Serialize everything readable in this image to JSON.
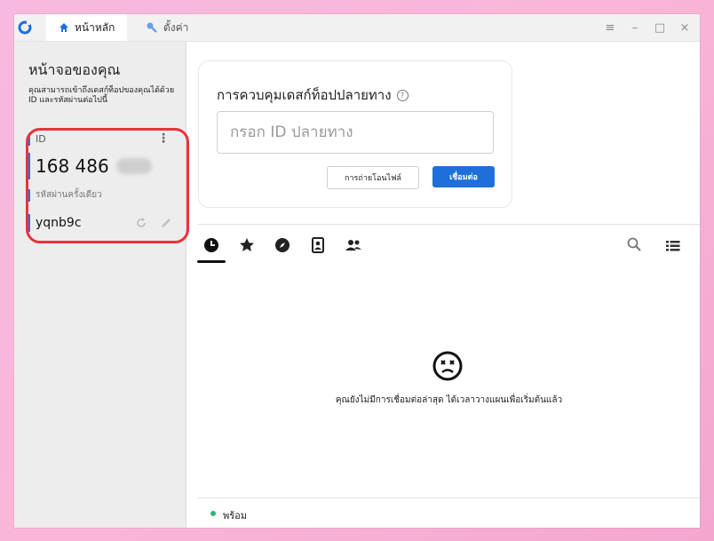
{
  "titlebar": {
    "tabs": [
      {
        "label": "หน้าหลัก",
        "icon": "home-icon"
      },
      {
        "label": "ตั้งค่า",
        "icon": "wrench-icon"
      }
    ],
    "controls": {
      "menu": "≡",
      "minimize": "–",
      "maximize": "□",
      "close": "×"
    }
  },
  "sidebar": {
    "title": "หน้าจอของคุณ",
    "description": "คุณสามารถเข้าถึงเดสก์ท็อปของคุณได้ด้วย ID และรหัสผ่านต่อไปนี้",
    "id_label": "ID",
    "id_value": "168 486",
    "password_label": "รหัสผ่านครั้งเดียว",
    "password_value": "yqnb9c"
  },
  "connect": {
    "title": "การควบคุมเดสก์ท็อปปลายทาง",
    "input_placeholder": "กรอก ID ปลายทาง",
    "transfer_button": "การถ่ายโอนไฟล์",
    "connect_button": "เชื่อมต่อ"
  },
  "tabs": [
    "recent-icon",
    "star-icon",
    "compass-icon",
    "address-book-icon",
    "group-icon"
  ],
  "empty_state": {
    "message": "คุณยังไม่มีการเชื่อมต่อล่าสุด ได้เวลาวางแผนเพื่อเริ่มต้นแล้ว"
  },
  "status": {
    "text": "พร้อม",
    "color": "#2bb673"
  },
  "colors": {
    "accent": "#1e6fdc",
    "highlight": "#e8333d"
  }
}
